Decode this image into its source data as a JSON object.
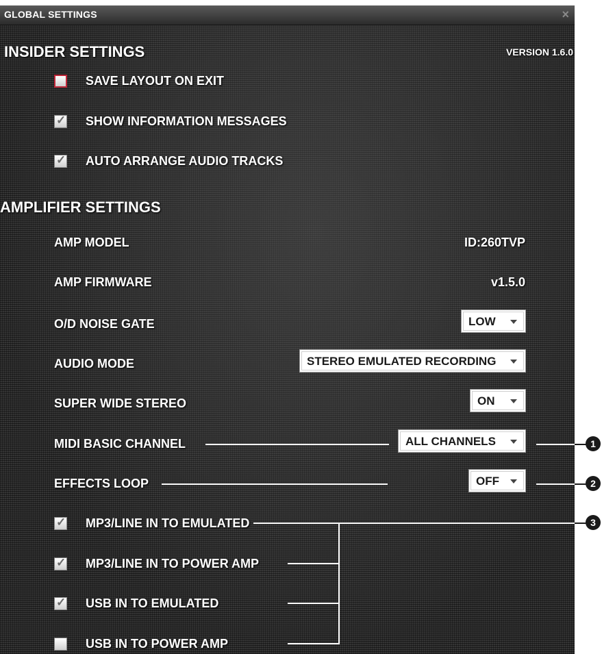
{
  "window": {
    "title": "GLOBAL SETTINGS",
    "close_glyph": "×"
  },
  "insider": {
    "heading": "INSIDER SETTINGS",
    "version": "VERSION 1.6.0",
    "options": [
      {
        "label": "SAVE LAYOUT ON EXIT",
        "checked": false
      },
      {
        "label": "SHOW INFORMATION MESSAGES",
        "checked": true
      },
      {
        "label": "AUTO ARRANGE AUDIO TRACKS",
        "checked": true
      }
    ]
  },
  "amplifier": {
    "heading": "AMPLIFIER SETTINGS",
    "amp_model": {
      "label": "AMP MODEL",
      "value": "ID:260TVP"
    },
    "amp_firmware": {
      "label": "AMP FIRMWARE",
      "value": "v1.5.0"
    },
    "noise_gate": {
      "label": "O/D NOISE GATE",
      "value": "LOW"
    },
    "audio_mode": {
      "label": "AUDIO MODE",
      "value": "STEREO EMULATED RECORDING"
    },
    "super_wide": {
      "label": "SUPER WIDE STEREO",
      "value": "ON"
    },
    "midi_channel": {
      "label": "MIDI BASIC CHANNEL",
      "value": "ALL CHANNELS"
    },
    "effects_loop": {
      "label": "EFFECTS LOOP",
      "value": "OFF"
    },
    "routing": [
      {
        "label": "MP3/LINE IN TO EMULATED",
        "checked": true
      },
      {
        "label": "MP3/LINE IN TO POWER AMP",
        "checked": true
      },
      {
        "label": "USB IN TO EMULATED",
        "checked": true
      },
      {
        "label": "USB IN TO POWER AMP",
        "checked": false
      }
    ]
  },
  "callouts": {
    "c1": "1",
    "c2": "2",
    "c3": "3"
  },
  "check_glyph": "✓"
}
